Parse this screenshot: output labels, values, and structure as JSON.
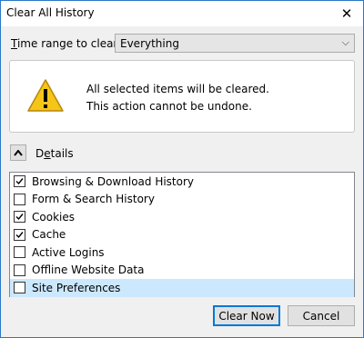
{
  "window": {
    "title": "Clear All History"
  },
  "range": {
    "label_pre": "",
    "label_ul": "T",
    "label_post": "ime range to clear:",
    "selected": "Everything"
  },
  "warning": {
    "line1": "All selected items will be cleared.",
    "line2": "This action cannot be undone."
  },
  "details": {
    "label_pre": "D",
    "label_ul": "e",
    "label_post": "tails"
  },
  "items": [
    {
      "label": "Browsing & Download History",
      "checked": true
    },
    {
      "label": "Form & Search History",
      "checked": false
    },
    {
      "label": "Cookies",
      "checked": true
    },
    {
      "label": "Cache",
      "checked": true
    },
    {
      "label": "Active Logins",
      "checked": false
    },
    {
      "label": "Offline Website Data",
      "checked": false
    },
    {
      "label": "Site Preferences",
      "checked": false
    }
  ],
  "buttons": {
    "clear": "Clear Now",
    "cancel": "Cancel"
  },
  "icons": {
    "close": "close-icon",
    "dropdown": "chevron-down-icon",
    "warning": "warning-icon",
    "toggle": "chevron-up-icon",
    "checkmark": "checkmark-icon"
  },
  "colors": {
    "accent": "#0078d7",
    "selection": "#cce8ff",
    "warning_fill": "#f5c518"
  }
}
